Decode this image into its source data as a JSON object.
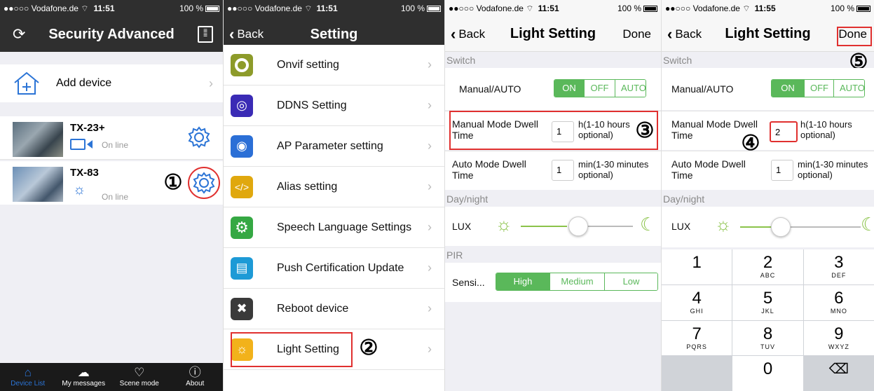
{
  "colors": {
    "accent": "#2b74d6",
    "green": "#5ab85a",
    "highlight": "#e0302f"
  },
  "status": {
    "p1": {
      "carrier": "●●○○○ Vodafone.de ⌔",
      "time": "11:51",
      "battery": "100 %"
    },
    "p2": {
      "carrier": "●●○○○ Vodafone.de ⌔",
      "time": "11:51",
      "battery": "100 %"
    },
    "p3": {
      "carrier": "●●○○○ Vodafone.de ⌔",
      "time": "11:51",
      "battery": "100 %"
    },
    "p4": {
      "carrier": "●●○○○ Vodafone.de ⌔",
      "time": "11:55",
      "battery": "100 %"
    }
  },
  "screen1": {
    "title": "Security Advanced",
    "add_device": "Add device",
    "devices": [
      {
        "name": "TX-23+",
        "status": "On line"
      },
      {
        "name": "TX-83",
        "status": "On line"
      }
    ],
    "tabs": [
      "Device List",
      "My messages",
      "Scene mode",
      "About"
    ]
  },
  "screen2": {
    "back": "Back",
    "title": "Setting",
    "items": [
      "Onvif setting",
      "DDNS Setting",
      "AP Parameter setting",
      "Alias setting",
      "Speech Language Settings",
      "Push Certification Update",
      "Reboot device",
      "Light Setting"
    ]
  },
  "screen3": {
    "back": "Back",
    "title": "Light Setting",
    "done": "Done",
    "switch_section": "Switch",
    "manual_auto_label": "Manual/AUTO",
    "segment": [
      "ON",
      "OFF",
      "AUTO"
    ],
    "manual_dwell_label": "Manual Mode Dwell Time",
    "manual_dwell_value": "1",
    "manual_dwell_hint": "h(1-10 hours optional)",
    "auto_dwell_label": "Auto Mode Dwell Time",
    "auto_dwell_value": "1",
    "auto_dwell_hint": "min(1-30 minutes optional)",
    "daynight_section": "Day/night",
    "lux_label": "LUX",
    "pir_section": "PIR",
    "sensitivity_label": "Sensi...",
    "pir_segment": [
      "High",
      "Medium",
      "Low"
    ]
  },
  "screen4": {
    "back": "Back",
    "title": "Light Setting",
    "done": "Done",
    "switch_section": "Switch",
    "manual_auto_label": "Manual/AUTO",
    "segment": [
      "ON",
      "OFF",
      "AUTO"
    ],
    "manual_dwell_label": "Manual Mode Dwell Time",
    "manual_dwell_value": "2",
    "manual_dwell_hint": "h(1-10 hours optional)",
    "auto_dwell_label": "Auto Mode Dwell Time",
    "auto_dwell_value": "1",
    "auto_dwell_hint": "min(1-30 minutes optional)",
    "daynight_section": "Day/night",
    "lux_label": "LUX",
    "keys": [
      {
        "d": "1",
        "s": ""
      },
      {
        "d": "2",
        "s": "ABC"
      },
      {
        "d": "3",
        "s": "DEF"
      },
      {
        "d": "4",
        "s": "GHI"
      },
      {
        "d": "5",
        "s": "JKL"
      },
      {
        "d": "6",
        "s": "MNO"
      },
      {
        "d": "7",
        "s": "PQRS"
      },
      {
        "d": "8",
        "s": "TUV"
      },
      {
        "d": "9",
        "s": "WXYZ"
      },
      {
        "d": "0",
        "s": ""
      }
    ]
  },
  "steps": [
    "①",
    "②",
    "③",
    "④",
    "⑤"
  ]
}
